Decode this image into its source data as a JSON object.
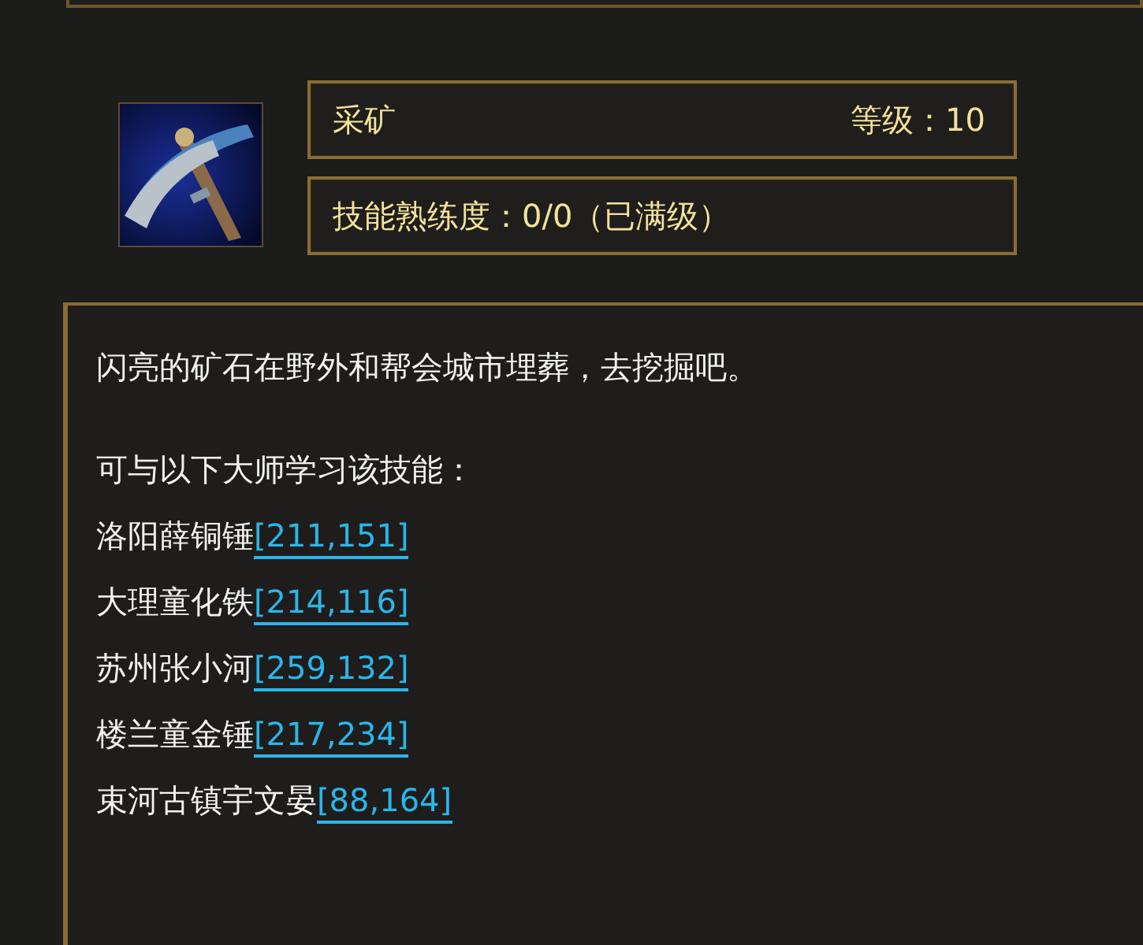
{
  "skill": {
    "name": "采矿",
    "level": "等级：10",
    "proficiency": "技能熟练度：0/0（已满级）"
  },
  "description": "闪亮的矿石在野外和帮会城市埋葬，去挖掘吧。",
  "masters_heading": "可与以下大师学习该技能：",
  "masters": [
    {
      "name": "洛阳薛铜锤",
      "coords": "[211,151]"
    },
    {
      "name": "大理童化铁",
      "coords": "[214,116]"
    },
    {
      "name": "苏州张小河",
      "coords": "[259,132]"
    },
    {
      "name": "楼兰童金锤",
      "coords": "[217,234]"
    },
    {
      "name": "束河古镇宇文晏",
      "coords": "[88,164]"
    }
  ]
}
